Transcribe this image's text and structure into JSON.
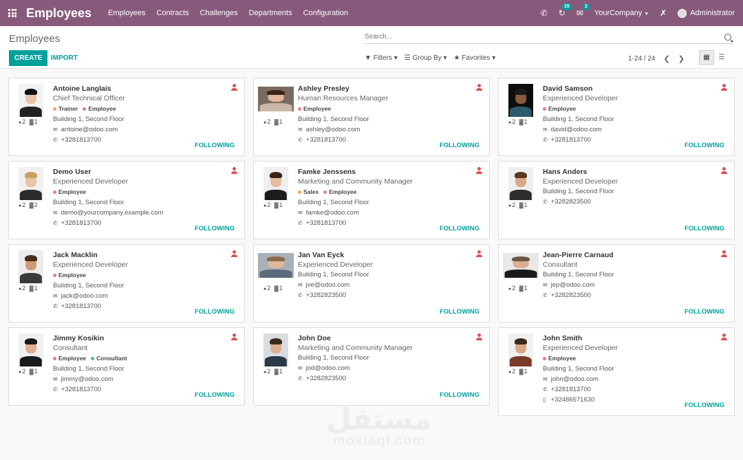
{
  "navbar": {
    "app_title": "Employees",
    "menu": [
      "Employees",
      "Contracts",
      "Challenges",
      "Departments",
      "Configuration"
    ],
    "activity_count": "15",
    "messages_count": "2",
    "company": "YourCompany",
    "user": "Administrator"
  },
  "control_panel": {
    "title": "Employees",
    "search_placeholder": "Search...",
    "create_label": "CREATE",
    "import_label": "IMPORT",
    "filters_label": "Filters",
    "groupby_label": "Group By",
    "favorites_label": "Favorites",
    "pager": "1-24 / 24"
  },
  "employees": [
    {
      "name": "Antoine Langlais",
      "job": "Chief Technical Officer",
      "tags": [
        "Trainer",
        "Employee"
      ],
      "location": "Building 1, Second Floor",
      "email": "antoine@odoo.com",
      "phone": "+3281813700",
      "messages": "2",
      "followers": "1",
      "following": "FOLLOWING"
    },
    {
      "name": "Ashley Presley",
      "job": "Human Resources Manager",
      "tags": [
        "Employee"
      ],
      "location": "Building 1, Second Floor",
      "email": "ashley@odoo.com",
      "phone": "+3281813700",
      "messages": "2",
      "followers": "1",
      "following": "FOLLOWING"
    },
    {
      "name": "David Samson",
      "job": "Experienced Developer",
      "tags": [
        "Employee"
      ],
      "location": "Building 1, Second Floor",
      "email": "david@odoo.com",
      "phone": "+3281813700",
      "messages": "2",
      "followers": "1",
      "following": "FOLLOWING"
    },
    {
      "name": "Demo User",
      "job": "Experienced Developer",
      "tags": [
        "Employee"
      ],
      "location": "Building 1, Second Floor",
      "email": "demo@yourcompany.example.com",
      "phone": "+3281813700",
      "messages": "2",
      "followers": "2",
      "following": "FOLLOWING"
    },
    {
      "name": "Famke Jenssens",
      "job": "Marketing and Community Manager",
      "tags": [
        "Sales",
        "Employee"
      ],
      "location": "Building 1, Second Floor",
      "email": "famke@odoo.com",
      "phone": "+3281813700",
      "messages": "2",
      "followers": "1",
      "following": "FOLLOWING"
    },
    {
      "name": "Hans Anders",
      "job": "Experienced Developer",
      "tags": [],
      "location": "Building 1, Second Floor",
      "email": "",
      "phone": "+3282823500",
      "messages": "2",
      "followers": "1",
      "following": "FOLLOWING"
    },
    {
      "name": "Jack Macklin",
      "job": "Experienced Developer",
      "tags": [
        "Employee"
      ],
      "location": "Building 1, Second Floor",
      "email": "jack@odoo.com",
      "phone": "+3281813700",
      "messages": "2",
      "followers": "1",
      "following": "FOLLOWING"
    },
    {
      "name": "Jan Van Eyck",
      "job": "Experienced Developer",
      "tags": [],
      "location": "Building 1, Second Floor",
      "email": "jve@odoo.com",
      "phone": "+3282823500",
      "messages": "2",
      "followers": "1",
      "following": "FOLLOWING"
    },
    {
      "name": "Jean-Pierre Carnaud",
      "job": "Consultant",
      "tags": [],
      "location": "Building 1, Second Floor",
      "email": "jep@odoo.com",
      "phone": "+3282823500",
      "messages": "2",
      "followers": "1",
      "following": "FOLLOWING"
    },
    {
      "name": "Jimmy Kosikin",
      "job": "Consultant",
      "tags": [
        "Employee",
        "Consultant"
      ],
      "location": "Building 1, Second Floor",
      "email": "jimmy@odoo.com",
      "phone": "+3281813700",
      "messages": "2",
      "followers": "1",
      "following": "FOLLOWING"
    },
    {
      "name": "John Doe",
      "job": "Marketing and Community Manager",
      "tags": [],
      "location": "Building 1, Second Floor",
      "email": "jod@odoo.com",
      "phone": "+3282823500",
      "messages": "2",
      "followers": "1",
      "following": "FOLLOWING"
    },
    {
      "name": "John Smith",
      "job": "Experienced Developer",
      "tags": [
        "Employee"
      ],
      "location": "Building 1, Second Floor",
      "email": "john@odoo.com",
      "phone": "+3281813700",
      "mobile": "+32486571630",
      "messages": "2",
      "followers": "1",
      "following": "FOLLOWING"
    }
  ],
  "watermark": {
    "arabic": "مستقل",
    "latin": "mostaql.com"
  }
}
